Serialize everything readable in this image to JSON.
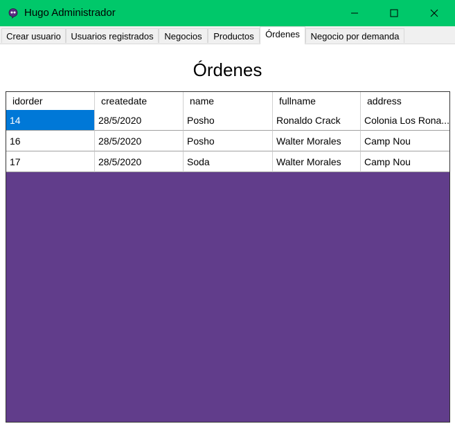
{
  "window": {
    "title": "Hugo Administrador",
    "icon": "app-icon",
    "controls": [
      "minimize-icon",
      "maximize-icon",
      "close-icon"
    ]
  },
  "tabs": [
    {
      "label": "Crear usuario",
      "active": false
    },
    {
      "label": "Usuarios registrados",
      "active": false
    },
    {
      "label": "Negocios",
      "active": false
    },
    {
      "label": "Productos",
      "active": false
    },
    {
      "label": "Órdenes",
      "active": true
    },
    {
      "label": "Negocio por demanda",
      "active": false
    }
  ],
  "page": {
    "title": "Órdenes"
  },
  "grid": {
    "columns": [
      "idorder",
      "createdate",
      "name",
      "fullname",
      "address"
    ],
    "rows": [
      [
        "14",
        "28/5/2020",
        "Posho",
        "Ronaldo Crack",
        "Colonia Los Rona..."
      ],
      [
        "16",
        "28/5/2020",
        "Posho",
        "Walter Morales",
        "Camp Nou"
      ],
      [
        "17",
        "28/5/2020",
        "Soda",
        "Walter Morales",
        "Camp Nou"
      ]
    ],
    "selected_cell": {
      "row": 0,
      "column": 0
    },
    "background_color": "#613d8b",
    "selection_color": "#0078d7"
  },
  "colors": {
    "titlebar": "#00c86a"
  }
}
